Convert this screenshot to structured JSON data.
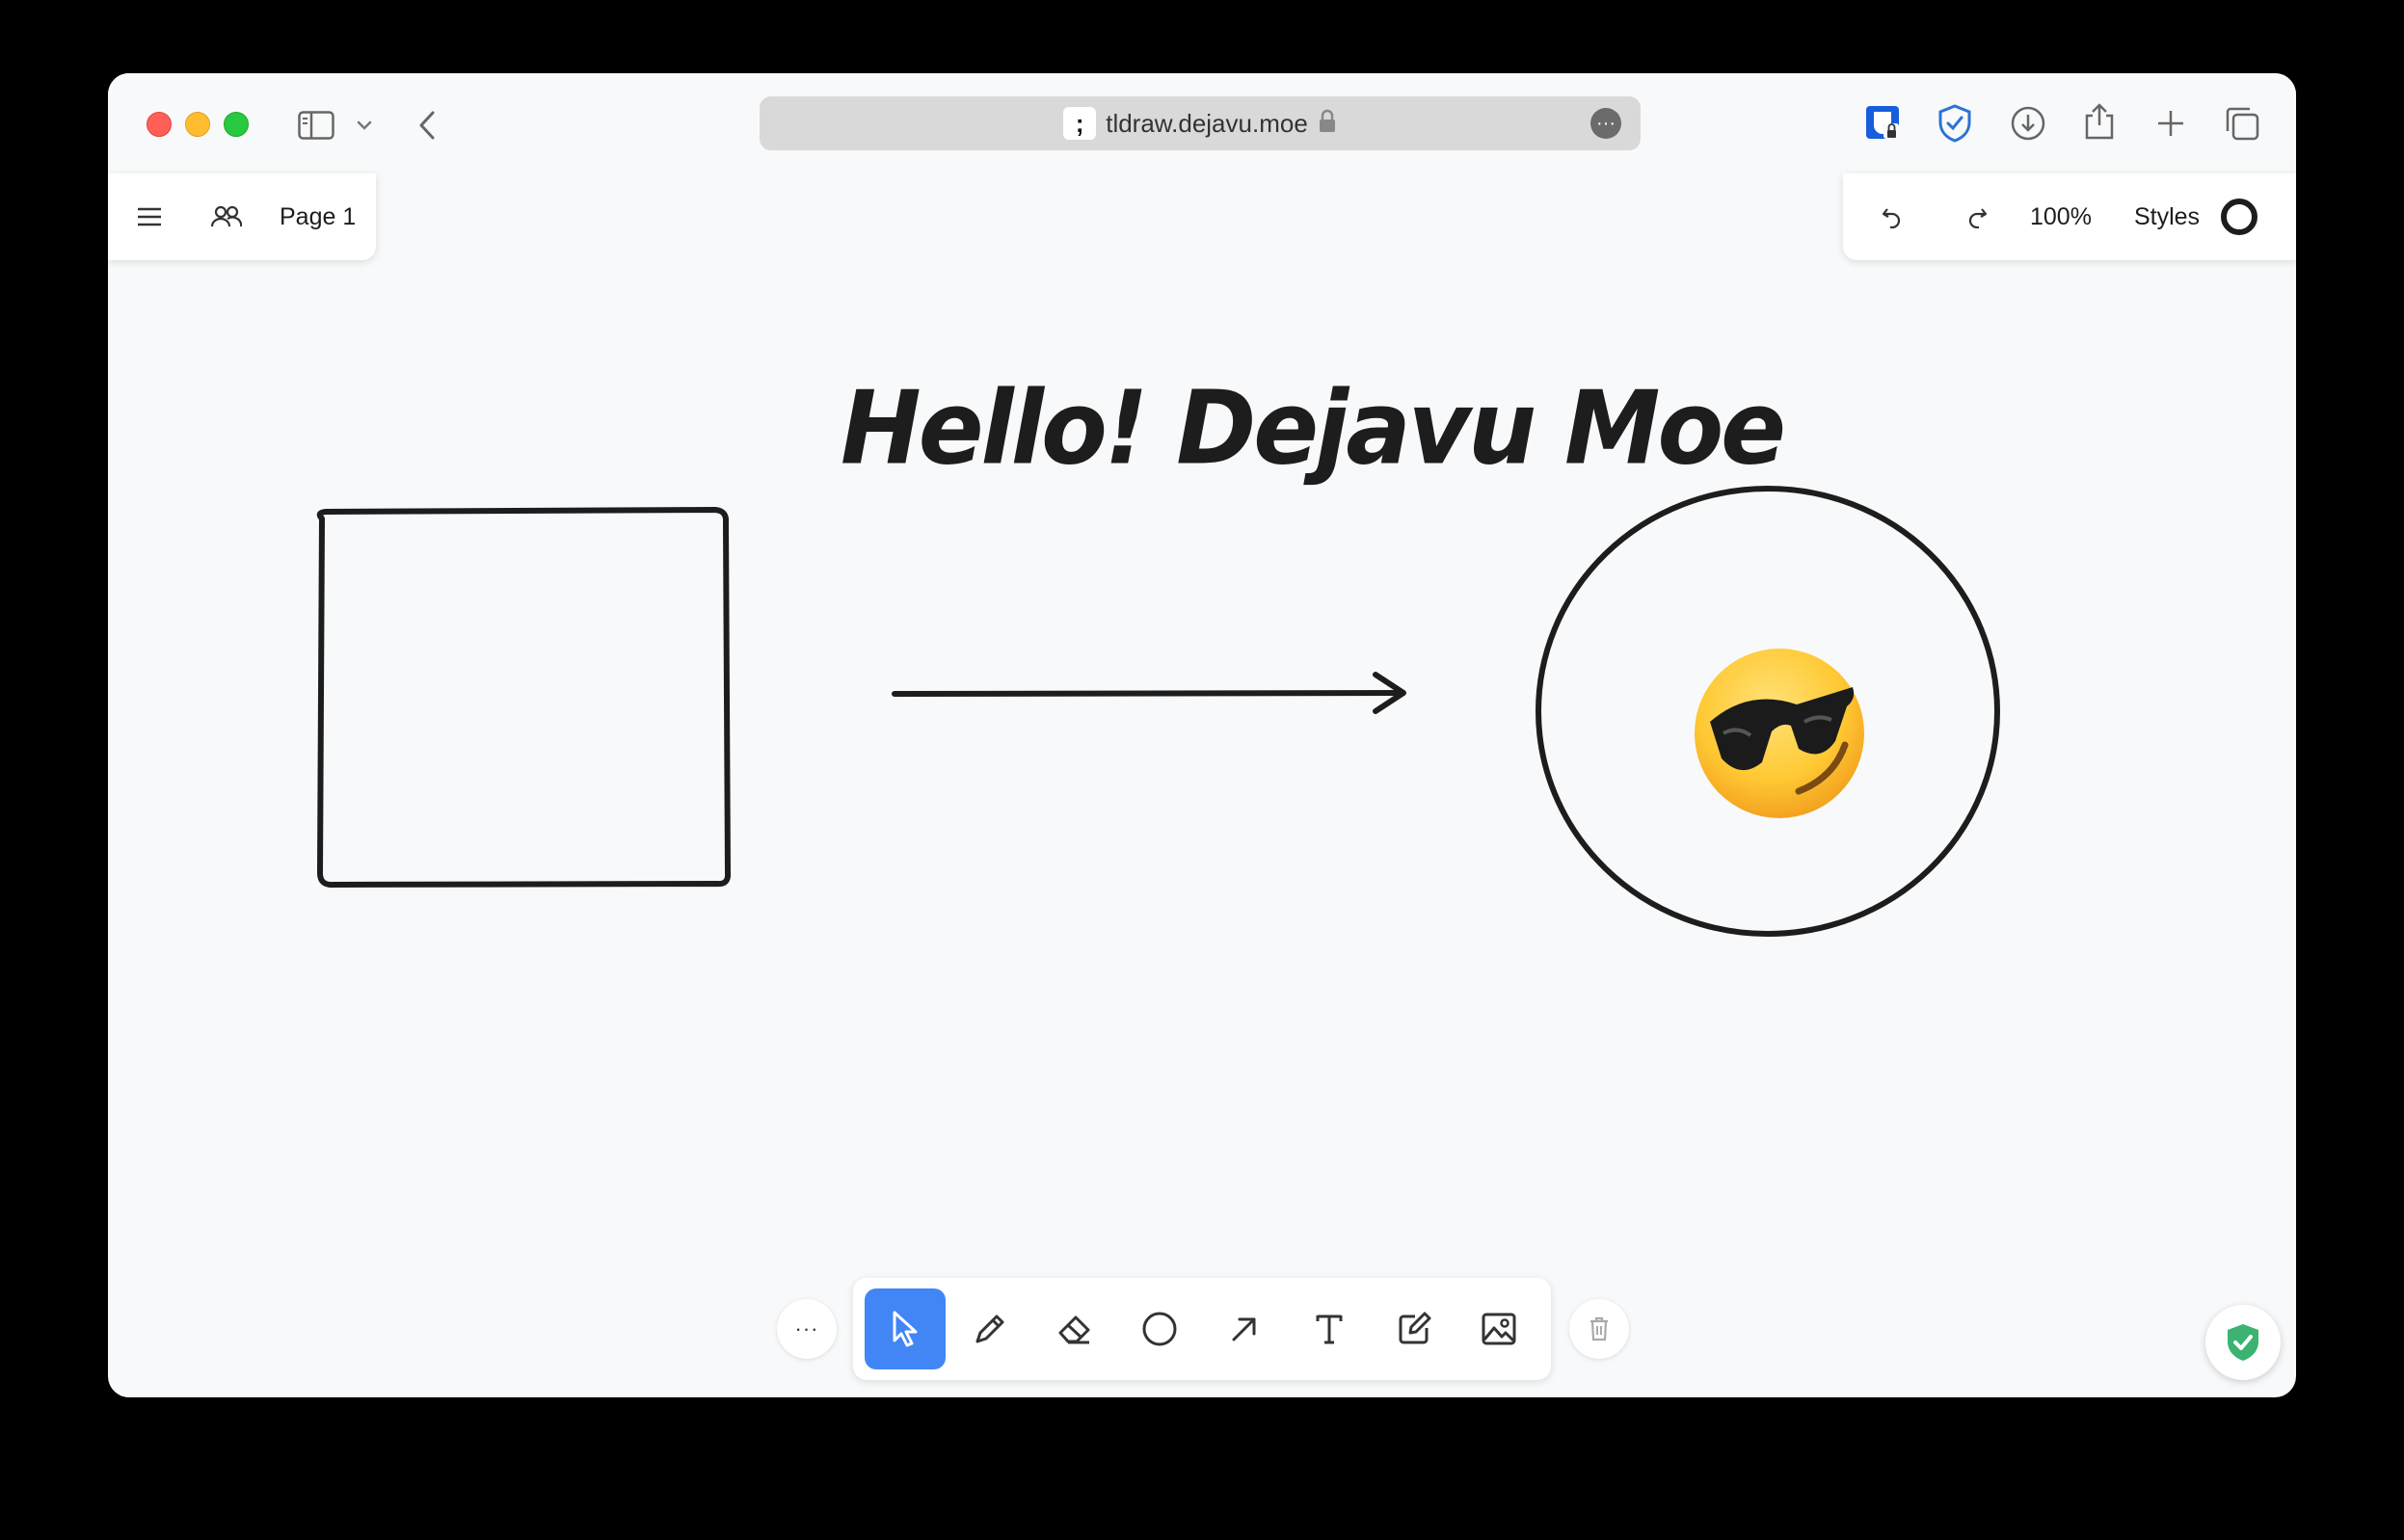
{
  "browser": {
    "url": "tldraw.dejavu.moe",
    "favicon_glyph": ";"
  },
  "app": {
    "page_label": "Page 1",
    "zoom": "100%",
    "styles_label": "Styles"
  },
  "canvas": {
    "heading": "Hello! Dejavu Moe",
    "emoji": "🥲"
  },
  "toolbar": {
    "more_label": "···",
    "tools": [
      "select",
      "draw",
      "eraser",
      "ellipse",
      "arrow",
      "text",
      "note",
      "image"
    ],
    "active_tool": "select"
  },
  "colors": {
    "accent": "#4285f4",
    "stroke": "#1d1d1d",
    "canvas_bg": "#f8f9fa"
  }
}
